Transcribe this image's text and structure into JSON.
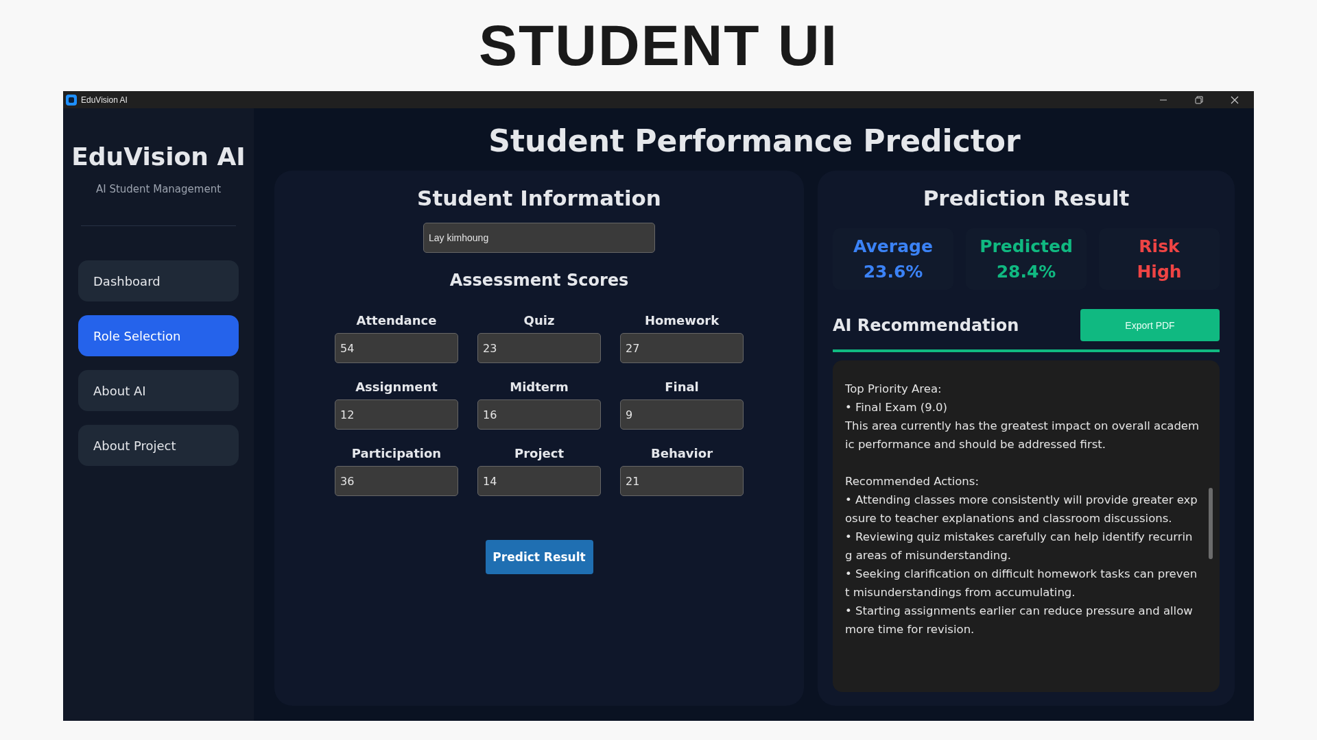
{
  "page_title": "STUDENT UI",
  "window": {
    "title": "EduVision AI"
  },
  "sidebar": {
    "brand": "EduVision AI",
    "subtitle": "AI Student Management",
    "items": [
      {
        "label": "Dashboard",
        "selected": false
      },
      {
        "label": "Role Selection",
        "selected": true
      },
      {
        "label": "About AI",
        "selected": false
      },
      {
        "label": "About Project",
        "selected": false
      }
    ]
  },
  "main_title": "Student Performance Predictor",
  "student_info": {
    "title": "Student Information",
    "name_value": "Lay kimhoung",
    "scores_title": "Assessment Scores",
    "scores": [
      {
        "label": "Attendance",
        "value": "54"
      },
      {
        "label": "Quiz",
        "value": "23"
      },
      {
        "label": "Homework",
        "value": "27"
      },
      {
        "label": "Assignment",
        "value": "12"
      },
      {
        "label": "Midterm",
        "value": "16"
      },
      {
        "label": "Final",
        "value": "9"
      },
      {
        "label": "Participation",
        "value": "36"
      },
      {
        "label": "Project",
        "value": "14"
      },
      {
        "label": "Behavior",
        "value": "21"
      }
    ],
    "button": "Predict Result"
  },
  "prediction": {
    "title": "Prediction Result",
    "stats": [
      {
        "label": "Average",
        "value": "23.6%",
        "color": "#3b82f6"
      },
      {
        "label": "Predicted",
        "value": "28.4%",
        "color": "#10b981"
      },
      {
        "label": "Risk",
        "value": "High",
        "color": "#ef4444"
      }
    ],
    "recommendation_title": "AI Recommendation",
    "export_button": "Export PDF",
    "sections": [
      {
        "heading": "Top Priority Area:",
        "lines": [
          "• Final Exam (9.0)",
          "This area currently has the greatest impact on overall academ",
          "ic performance and should be addressed first."
        ]
      },
      {
        "heading": "Recommended Actions:",
        "lines": [
          "• Attending classes more consistently will provide greater exp",
          "osure to teacher explanations and classroom discussions.",
          "• Reviewing quiz mistakes carefully can help identify recurrin",
          "g areas of misunderstanding.",
          "• Seeking clarification on difficult homework tasks can preven",
          "t misunderstandings from accumulating.",
          "• Starting assignments earlier can reduce pressure and allow",
          "more time for revision."
        ]
      }
    ]
  }
}
